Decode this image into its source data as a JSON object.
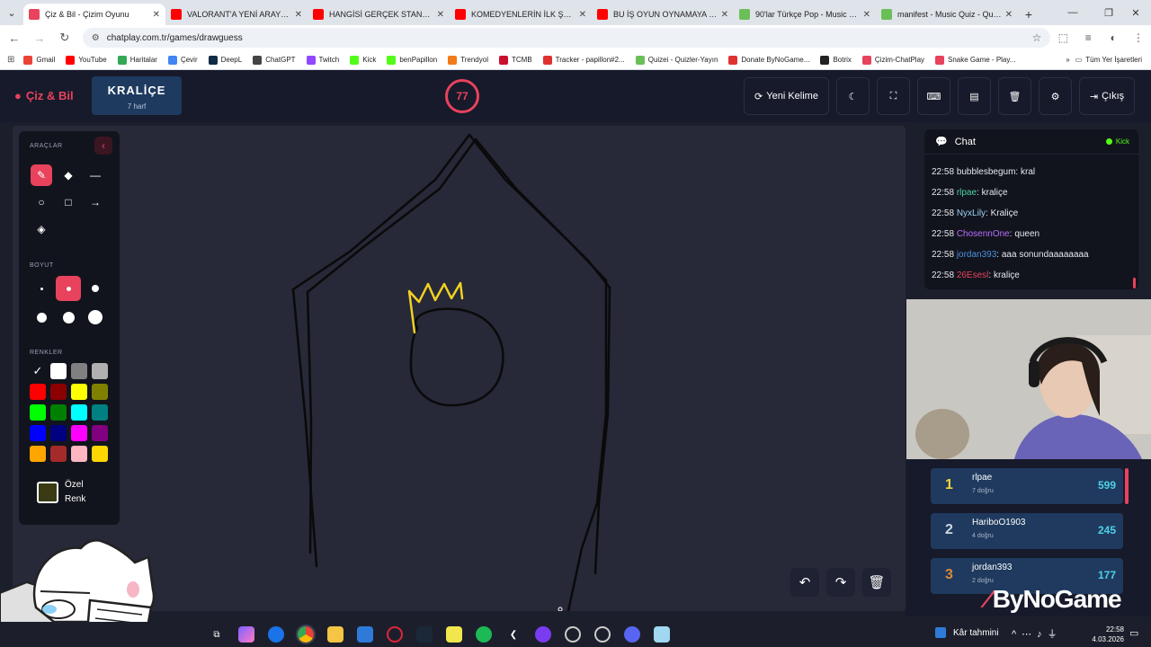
{
  "browser": {
    "tabs": [
      {
        "title": "Çiz & Bil - Çizim Oyunu",
        "active": true,
        "color": "#e8425d"
      },
      {
        "title": "VALORANT'A YENİ ARAYÜZ VE",
        "active": false,
        "color": "#ff0000"
      },
      {
        "title": "HANGİSİ GERÇEK STAND-UP K",
        "active": false,
        "color": "#ff0000"
      },
      {
        "title": "KOMEDYENLERİN İLK ŞAKALAR",
        "active": false,
        "color": "#ff0000"
      },
      {
        "title": "BU İŞ OYUN OYNAMAYA BENZ",
        "active": false,
        "color": "#ff0000"
      },
      {
        "title": "90'lar Türkçe Pop - Music Quiz",
        "active": false,
        "color": "#6bbf59"
      },
      {
        "title": "manifest - Music Quiz - Quizei",
        "active": false,
        "color": "#6bbf59"
      }
    ],
    "new_tab": "+",
    "url": "chatplay.com.tr/games/drawguess",
    "bookmarks": [
      {
        "label": "Gmail",
        "color": "#ea4335"
      },
      {
        "label": "YouTube",
        "color": "#ff0000"
      },
      {
        "label": "Haritalar",
        "color": "#34a853"
      },
      {
        "label": "Çevir",
        "color": "#4285f4"
      },
      {
        "label": "DeepL",
        "color": "#0f2b46"
      },
      {
        "label": "ChatGPT",
        "color": "#444444"
      },
      {
        "label": "Twitch",
        "color": "#9146ff"
      },
      {
        "label": "Kick",
        "color": "#53fc18"
      },
      {
        "label": "benPapillon",
        "color": "#53fc18"
      },
      {
        "label": "Trendyol",
        "color": "#f27a1a"
      },
      {
        "label": "TCMB",
        "color": "#c8102e"
      },
      {
        "label": "Tracker - papillon#2...",
        "color": "#e03131"
      },
      {
        "label": "Quizei - Quizler-Yayın",
        "color": "#6bbf59"
      },
      {
        "label": "Donate ByNoGame...",
        "color": "#e03131"
      },
      {
        "label": "Botrix",
        "color": "#222222"
      },
      {
        "label": "Çizim-ChatPlay",
        "color": "#e8425d"
      },
      {
        "label": "Snake Game - Play...",
        "color": "#e8425d"
      }
    ],
    "bookmarks_more": "»",
    "all_bookmarks": "Tüm Yer İşaretleri"
  },
  "header": {
    "logo": "Çiz & Bil",
    "word": "KRALİÇE",
    "word_hint": "7 harf",
    "timer": "77",
    "new_word": "Yeni Kelime",
    "exit": "Çıkış"
  },
  "tools": {
    "section_tools": "ARAÇLAR",
    "section_size": "BOYUT",
    "section_colors": "RENKLER",
    "custom_color_label": "Özel Renk",
    "colors": [
      "#000000",
      "#ffffff",
      "#808080",
      "#b0b0b0",
      "#ff0000",
      "#8b0000",
      "#ffff00",
      "#808000",
      "#00ff00",
      "#008000",
      "#00ffff",
      "#008080",
      "#0000ff",
      "#000080",
      "#ff00ff",
      "#800080",
      "#ffa500",
      "#a52a2a",
      "#ffb6c1",
      "#ffd700"
    ]
  },
  "chat": {
    "title": "Chat",
    "platform": "Kick",
    "messages": [
      {
        "time": "22:58",
        "user": "bubblesbegum",
        "text": "kral",
        "color": "#e6e8f0"
      },
      {
        "time": "22:58",
        "user": "rlpae",
        "text": "kraliçe",
        "color": "#4fd1a8"
      },
      {
        "time": "22:58",
        "user": "NyxLily",
        "text": "Kraliçe",
        "color": "#9ad0f5"
      },
      {
        "time": "22:58",
        "user": "ChosennOne",
        "text": "queen",
        "color": "#b66dff"
      },
      {
        "time": "22:58",
        "user": "jordan393",
        "text": "aaa sonundaaaaaaaa",
        "color": "#4a90e2"
      },
      {
        "time": "22:58",
        "user": "26Esesl",
        "text": "kraliçe",
        "color": "#e8425d"
      }
    ]
  },
  "leaderboard": [
    {
      "rank": "1",
      "name": "rlpae",
      "sub": "7 doğru",
      "score": "599",
      "rank_color": "#f5d142"
    },
    {
      "rank": "2",
      "name": "HariboO1903",
      "sub": "4 doğru",
      "score": "245",
      "rank_color": "#d0d6e0"
    },
    {
      "rank": "3",
      "name": "jordan393",
      "sub": "2 doğru",
      "score": "177",
      "rank_color": "#d9883a"
    }
  ],
  "overlay_brand": "ByNoGame",
  "taskbar": {
    "weather": "Kâr tahmini",
    "time": "22:58",
    "date": "4.03.2026"
  }
}
